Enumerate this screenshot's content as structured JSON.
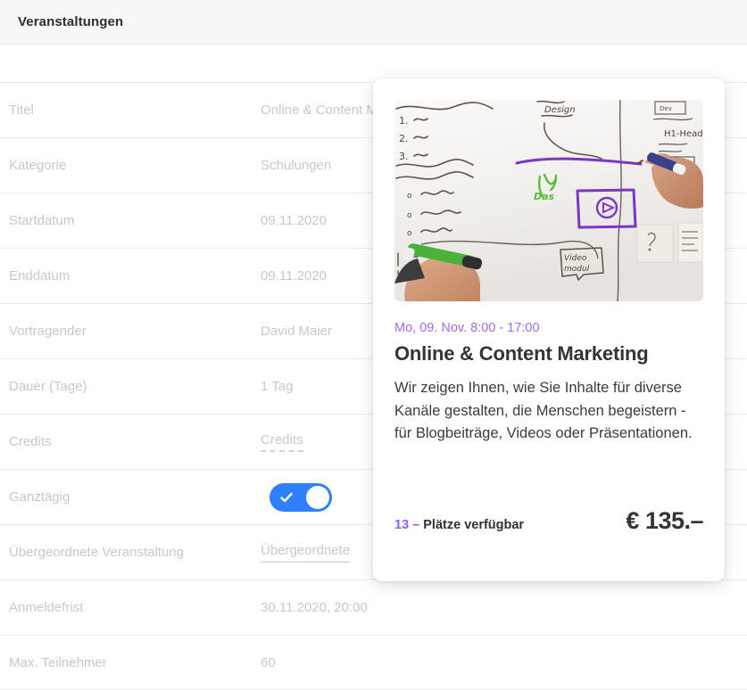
{
  "header": {
    "title": "Veranstaltungen"
  },
  "detail_table": {
    "rows": [
      {
        "label": "Titel",
        "value": "Online & Content Marketing",
        "style": "plain"
      },
      {
        "label": "Kategorie",
        "value": "Schulungen",
        "style": "plain"
      },
      {
        "label": "Startdatum",
        "value": "09.11.2020",
        "style": "plain"
      },
      {
        "label": "Enddatum",
        "value": "09.11.2020",
        "style": "plain"
      },
      {
        "label": "Vortragender",
        "value": "David Maier",
        "style": "plain"
      },
      {
        "label": "Dauer (Tage)",
        "value": "1 Tag",
        "style": "plain"
      },
      {
        "label": "Credits",
        "value": "Credits",
        "style": "dashed-underline"
      },
      {
        "label": "Ganztägig",
        "value": "",
        "style": "toggle"
      },
      {
        "label": "Übergeordnete Veranstaltung",
        "value": "Übergeordnete",
        "style": "solid-underline"
      },
      {
        "label": "Anmeldefrist",
        "value": "30.11.2020, 20:00",
        "style": "plain"
      },
      {
        "label": "Max. Teilnehmer",
        "value": "60",
        "style": "plain"
      }
    ]
  },
  "toggle": {
    "state": "on",
    "icon": "check-icon",
    "on_color": "#2f80ff",
    "knob_color": "#ffffff"
  },
  "event_card": {
    "image_alt": "whiteboard-sketching-photo",
    "date": "Mo, 09. Nov. 8:00 - 17:00",
    "date_color": "#a16bec",
    "title": "Online & Content Marketing",
    "description": "Wir zeigen Ihnen, wie Sie Inhalte für diverse Kanäle gestalten, die Menschen begeistern - für Blogbeiträge, Videos oder Präsentationen.",
    "seats_count": "13 –",
    "seats_label": "Plätze verfügbar",
    "seats_count_color": "#8b5cf6",
    "price": "€ 135.–"
  }
}
